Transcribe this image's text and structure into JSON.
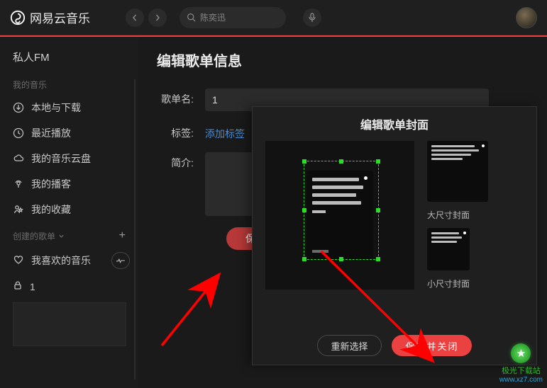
{
  "header": {
    "app_name": "网易云音乐",
    "search_placeholder": "陈奕迅"
  },
  "sidebar": {
    "personal_fm": "私人FM",
    "group_my_music": "我的音乐",
    "local_download": "本地与下载",
    "recent_play": "最近播放",
    "music_cloud": "我的音乐云盘",
    "my_podcast": "我的播客",
    "my_collection": "我的收藏",
    "created_playlist": "创建的歌单",
    "liked_music": "我喜欢的音乐",
    "locked_item": "1"
  },
  "main": {
    "title": "编辑歌单信息",
    "label_name": "歌单名:",
    "name_value": "1",
    "label_tags": "标签:",
    "add_tags": "添加标签",
    "label_intro": "简介:",
    "save": "保存"
  },
  "cover_panel": {
    "title": "编辑歌单封面",
    "big_label": "大尺寸封面",
    "small_label": "小尺寸封面",
    "reselect": "重新选择",
    "save_close": "保存并关闭"
  },
  "watermark": {
    "text": "极光下载站",
    "url": "www.xz7.com"
  }
}
